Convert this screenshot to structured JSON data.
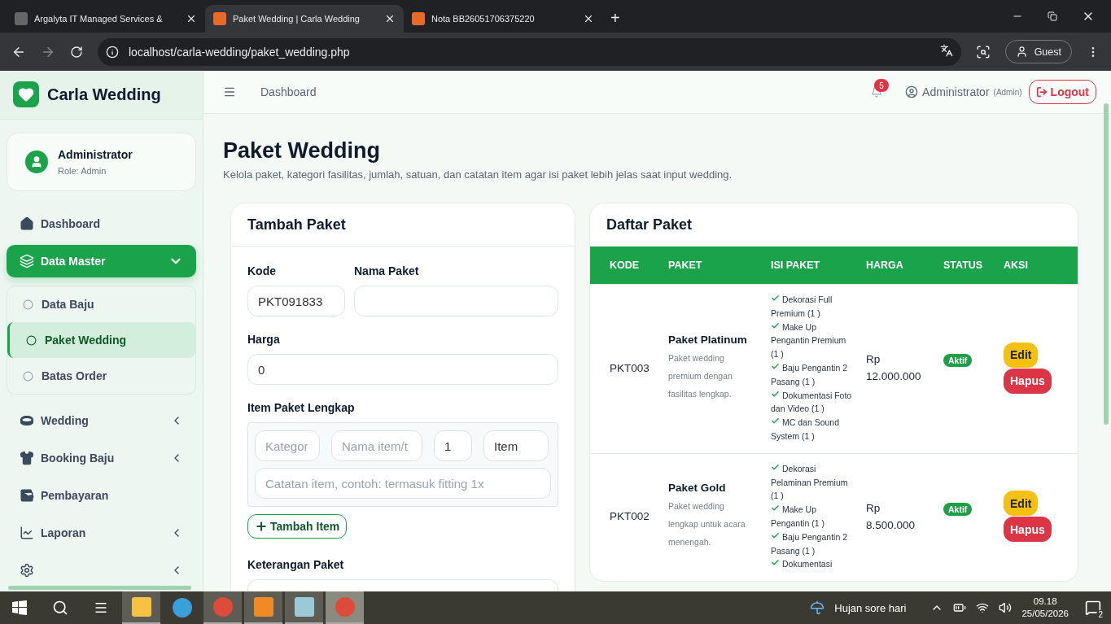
{
  "browser": {
    "tabs": [
      {
        "title": "Argalyta IT Managed Services &",
        "selected": false
      },
      {
        "title": "Paket Wedding | Carla Wedding",
        "selected": true
      },
      {
        "title": "Nota BB26051706375220",
        "selected": false
      }
    ],
    "new_tab": "+",
    "address": "localhost/carla-wedding/paket_wedding.php",
    "profile": "Guest"
  },
  "sidebar": {
    "brand": "Carla Wedding",
    "user": {
      "name": "Administrator",
      "role": "Role: Admin"
    },
    "nav": [
      {
        "label": "Dashboard",
        "selected": false
      },
      {
        "label": "Data Master",
        "selected": true,
        "expanded": true,
        "children": [
          {
            "label": "Data Baju",
            "selected": false
          },
          {
            "label": "Paket Wedding",
            "selected": true
          },
          {
            "label": "Batas Order",
            "selected": false
          }
        ]
      },
      {
        "label": "Wedding",
        "selected": false,
        "expanded": false
      },
      {
        "label": "Booking Baju",
        "selected": false,
        "expanded": false
      },
      {
        "label": "Pembayaran",
        "selected": false
      },
      {
        "label": "Laporan",
        "selected": false,
        "expanded": false
      },
      {
        "selected": false,
        "expanded": false
      }
    ]
  },
  "topbar": {
    "breadcrumb": "Dashboard",
    "notifications": "5",
    "user": "Administrator",
    "role": "(Admin)",
    "logout": "Logout"
  },
  "page": {
    "title": "Paket Wedding",
    "subtitle": "Kelola paket, kategori fasilitas, jumlah, satuan, dan catatan item agar isi paket lebih jelas saat input wedding."
  },
  "form": {
    "title": "Tambah Paket",
    "code_label": "Kode",
    "code_value": "PKT091833",
    "name_label": "Nama Paket",
    "price_label": "Harga",
    "price_value": "0",
    "items_label": "Item Paket Lengkap",
    "item_row": {
      "category_placeholder": "Kategor",
      "name_placeholder": "Nama item/t",
      "qty_value": "1",
      "unit_value": "Item",
      "note_placeholder": "Catatan item, contoh: termasuk fitting 1x"
    },
    "add_item": "Tambah Item",
    "desc_label": "Keterangan Paket"
  },
  "table": {
    "title": "Daftar Paket",
    "columns": [
      "KODE",
      "PAKET",
      "ISI PAKET",
      "HARGA",
      "STATUS",
      "AKSI"
    ],
    "rows": [
      {
        "code": "PKT003",
        "name": "Paket Platinum",
        "description": "Paket wedding premium dengan fasilitas lengkap.",
        "items": [
          "Dekorasi Full Premium (1 )",
          "Make Up Pengantin Premium (1 )",
          "Baju Pengantin 2 Pasang (1 )",
          "Dokumentasi Foto dan Video (1 )",
          "MC dan Sound System (1 )"
        ],
        "price": "Rp 12.000.000",
        "status": "Aktif",
        "active": true,
        "actions": [
          "Edit",
          "Hapus"
        ]
      },
      {
        "code": "PKT002",
        "name": "Paket Gold",
        "description": "Paket wedding lengkap untuk acara menengah.",
        "items": [
          "Dekorasi Pelaminan Premium (1 )",
          "Make Up Pengantin (1 )",
          "Baju Pengantin 2 Pasang (1 )",
          "Dokumentasi"
        ],
        "price": "Rp 8.500.000",
        "status": "Aktif",
        "active": true,
        "actions": [
          "Edit",
          "Hapus"
        ]
      }
    ]
  },
  "taskbar": {
    "apps": [
      {
        "running": true,
        "selected": false
      },
      {
        "running": false,
        "selected": false
      },
      {
        "running": true,
        "selected": false
      },
      {
        "running": true,
        "selected": false
      },
      {
        "running": true,
        "selected": false
      },
      {
        "running": true,
        "selected": true
      }
    ],
    "weather": "Hujan sore hari",
    "time": "09.18",
    "date": "25/05/2026",
    "notifications": "2"
  }
}
